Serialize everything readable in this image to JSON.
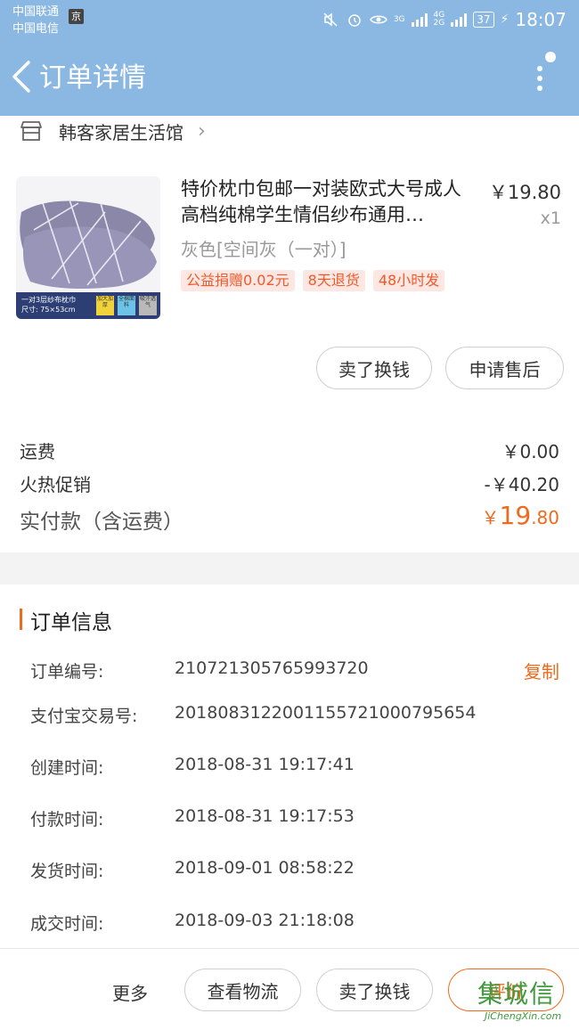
{
  "status_bar": {
    "carrier_1": "中国联通",
    "carrier_2": "中国电信",
    "app_badge": "京",
    "net_top": "3G",
    "net_mid": "4G",
    "net_bottom": "2G",
    "battery": "37",
    "time": "18:07"
  },
  "header": {
    "title": "订单详情"
  },
  "store": {
    "name": "韩客家居生活馆"
  },
  "product": {
    "title": "特价枕巾包邮一对装欧式大号成人高档纯棉学生情侣纱布通用…",
    "price": "￥19.80",
    "qty": "x1",
    "sku": "灰色[空间灰（一对）]",
    "tags": [
      "公益捐赠0.02元",
      "8天退货",
      "48小时发"
    ],
    "image_caption_line1": "一对3层纱布枕巾",
    "image_caption_line2": "尺寸: 75×53cm",
    "image_tags": [
      "加大加厚",
      "全棉面料",
      "吸汗透气"
    ]
  },
  "actions": {
    "sell_label": "卖了换钱",
    "after_sale_label": "申请售后"
  },
  "fees": {
    "shipping_label": "运费",
    "shipping_value": "￥0.00",
    "promo_label": "火热促销",
    "promo_value": "-￥40.20",
    "paid_label": "实付款（含运费）",
    "paid_symbol": "￥",
    "paid_int": "19",
    "paid_dec": ".80"
  },
  "order_info": {
    "title": "订单信息",
    "copy_label": "复制",
    "rows": [
      {
        "label": "订单编号:",
        "value": "210721305765993720"
      },
      {
        "label": "支付宝交易号:",
        "value": "2018083122001155721000795654"
      },
      {
        "label": "创建时间:",
        "value": "2018-08-31 19:17:41"
      },
      {
        "label": "付款时间:",
        "value": "2018-08-31 19:17:53"
      },
      {
        "label": "发货时间:",
        "value": "2018-09-01 08:58:22"
      },
      {
        "label": "成交时间:",
        "value": "2018-09-03 21:18:08"
      }
    ]
  },
  "bottom_bar": {
    "more_label": "更多",
    "logistics_label": "查看物流",
    "sell_label": "卖了换钱",
    "review_label": "评价"
  },
  "watermark": {
    "main": "集城信",
    "sub": "JiChengXin.com"
  },
  "colors": {
    "header_bg": "#8bb8e2",
    "accent": "#ef6a1c",
    "tag_bg": "#fde7e2",
    "tag_text": "#ef5a2c"
  }
}
